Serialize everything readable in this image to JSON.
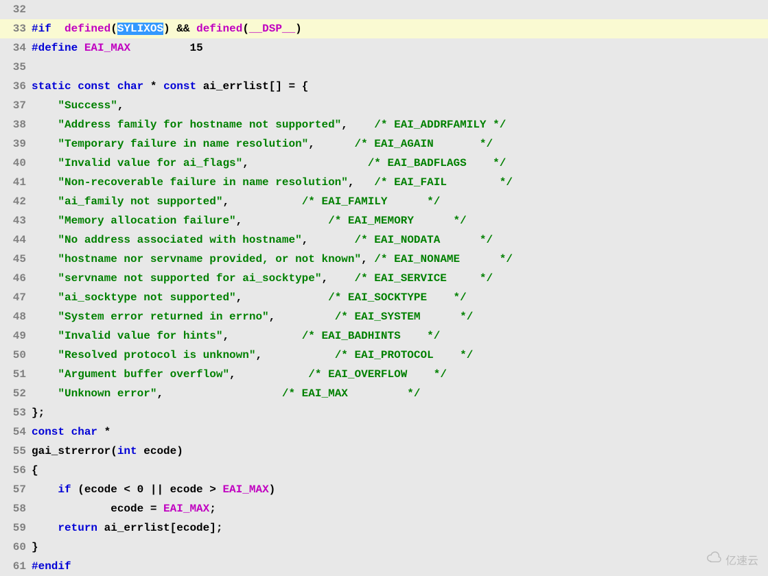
{
  "editor": {
    "highlighted_line": 33,
    "selection_text": "SYLIXOS",
    "lines": {
      "l32": "",
      "l33": {
        "pre": "#if",
        "defined1": "defined",
        "p1a": "(",
        "sel": "SYLIXOS",
        "p1b": ")",
        "amp": "&&",
        "defined2": "defined",
        "p2a": "(",
        "dsp": "__DSP__",
        "p2b": ")"
      },
      "l34": {
        "pre": "#define",
        "mac": "EAI_MAX",
        "val": "15"
      },
      "l35": "",
      "l36": {
        "kw1": "static",
        "kw2": "const",
        "kw3": "char",
        "star1": "*",
        "kw4": "const",
        "name": "ai_errlist[] = {"
      },
      "l37": {
        "str": "\"Success\"",
        "comma": ","
      },
      "l38": {
        "str": "\"Address family for hostname not supported\"",
        "comma": ",",
        "cmt": "/* EAI_ADDRFAMILY */"
      },
      "l39": {
        "str": "\"Temporary failure in name resolution\"",
        "comma": ",",
        "cmt": "/* EAI_AGAIN       */"
      },
      "l40": {
        "str": "\"Invalid value for ai_flags\"",
        "comma": ",",
        "cmt": "/* EAI_BADFLAGS    */"
      },
      "l41": {
        "str": "\"Non-recoverable failure in name resolution\"",
        "comma": ",",
        "cmt": "/* EAI_FAIL        */"
      },
      "l42": {
        "str": "\"ai_family not supported\"",
        "comma": ",",
        "cmt": "/* EAI_FAMILY      */"
      },
      "l43": {
        "str": "\"Memory allocation failure\"",
        "comma": ",",
        "cmt": "/* EAI_MEMORY      */"
      },
      "l44": {
        "str": "\"No address associated with hostname\"",
        "comma": ",",
        "cmt": "/* EAI_NODATA      */"
      },
      "l45": {
        "str": "\"hostname nor servname provided, or not known\"",
        "comma": ",",
        "cmt": "/* EAI_NONAME      */"
      },
      "l46": {
        "str": "\"servname not supported for ai_socktype\"",
        "comma": ",",
        "cmt": "/* EAI_SERVICE     */"
      },
      "l47": {
        "str": "\"ai_socktype not supported\"",
        "comma": ",",
        "cmt": "/* EAI_SOCKTYPE    */"
      },
      "l48": {
        "str": "\"System error returned in errno\"",
        "comma": ",",
        "cmt": "/* EAI_SYSTEM      */"
      },
      "l49": {
        "str": "\"Invalid value for hints\"",
        "comma": ",",
        "cmt": "/* EAI_BADHINTS    */"
      },
      "l50": {
        "str": "\"Resolved protocol is unknown\"",
        "comma": ",",
        "cmt": "/* EAI_PROTOCOL    */"
      },
      "l51": {
        "str": "\"Argument buffer overflow\"",
        "comma": ",",
        "cmt": "/* EAI_OVERFLOW    */"
      },
      "l52": {
        "str": "\"Unknown error\"",
        "comma": ",",
        "cmt": "/* EAI_MAX         */"
      },
      "l53": "};",
      "l54": {
        "kw1": "const",
        "kw2": "char",
        "star": "*"
      },
      "l55": {
        "fn": "gai_strerror(",
        "kw": "int",
        "rest": " ecode)"
      },
      "l56": "{",
      "l57": {
        "kw": "if",
        "a": " (ecode < ",
        "n0": "0",
        "b": " || ecode > ",
        "mac": "EAI_MAX",
        "c": ")"
      },
      "l58": {
        "a": "ecode = ",
        "mac": "EAI_MAX",
        "b": ";"
      },
      "l59": {
        "kw": "return",
        "a": " ai_errlist[ecode];"
      },
      "l60": "}",
      "l61": {
        "pre": "#endif"
      }
    },
    "line_numbers": {
      "n32": "32",
      "n33": "33",
      "n34": "34",
      "n35": "35",
      "n36": "36",
      "n37": "37",
      "n38": "38",
      "n39": "39",
      "n40": "40",
      "n41": "41",
      "n42": "42",
      "n43": "43",
      "n44": "44",
      "n45": "45",
      "n46": "46",
      "n47": "47",
      "n48": "48",
      "n49": "49",
      "n50": "50",
      "n51": "51",
      "n52": "52",
      "n53": "53",
      "n54": "54",
      "n55": "55",
      "n56": "56",
      "n57": "57",
      "n58": "58",
      "n59": "59",
      "n60": "60",
      "n61": "61"
    }
  },
  "watermark": {
    "text": "亿速云"
  }
}
